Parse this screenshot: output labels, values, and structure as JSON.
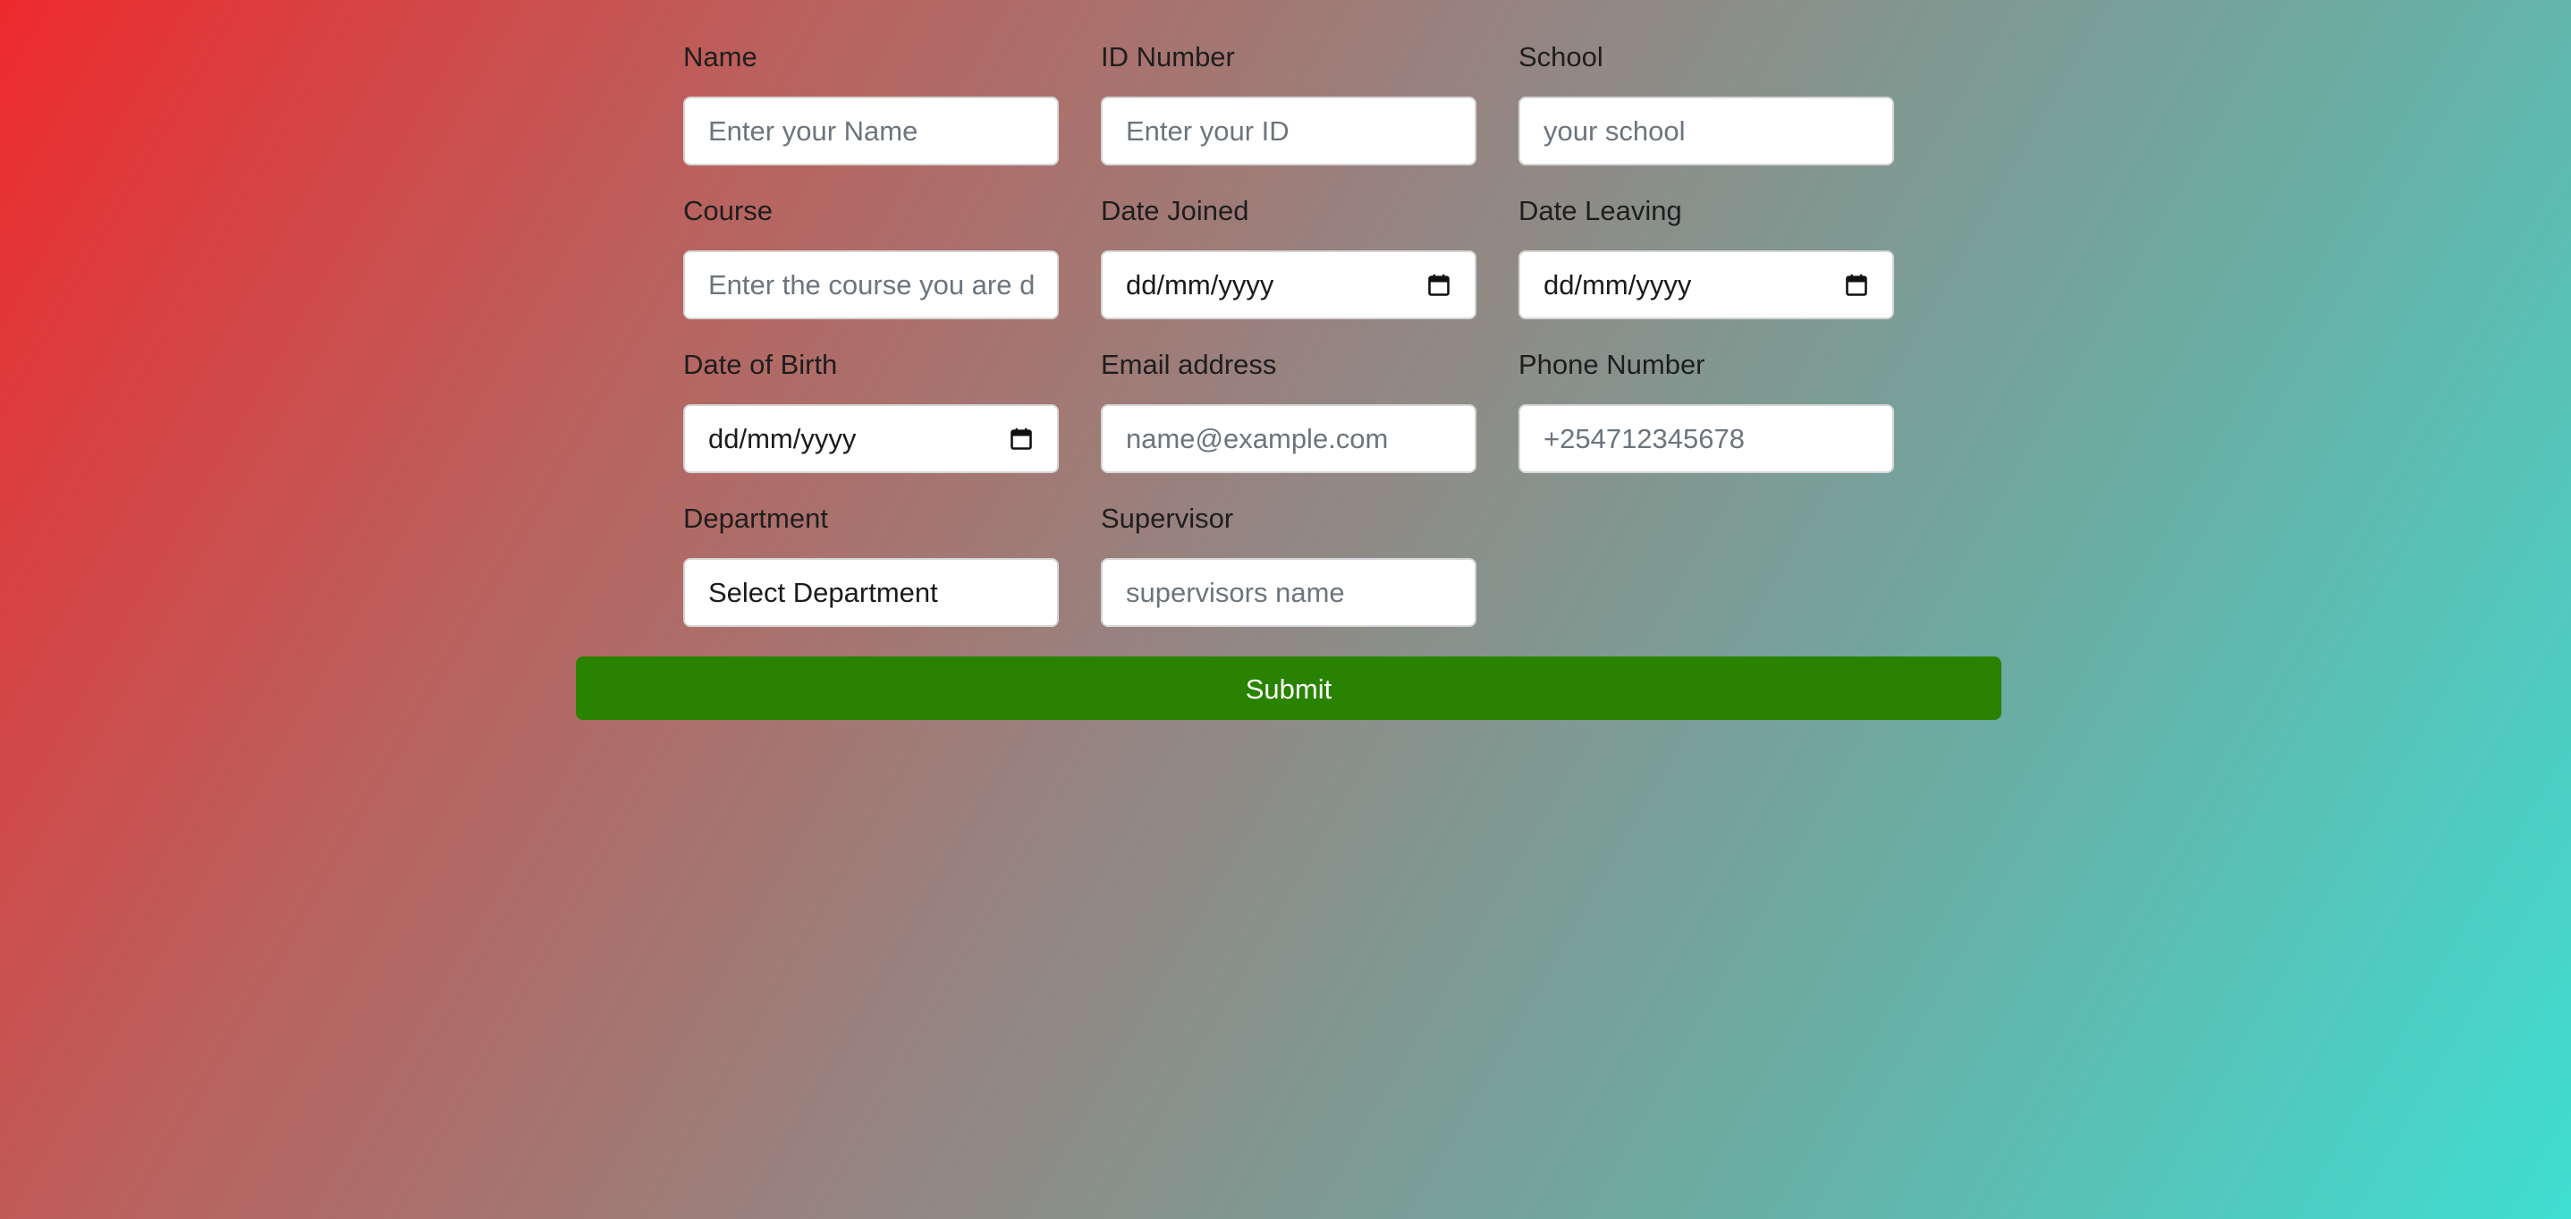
{
  "form": {
    "name": {
      "label": "Name",
      "placeholder": "Enter your Name"
    },
    "id_number": {
      "label": "ID Number",
      "placeholder": "Enter your ID"
    },
    "school": {
      "label": "School",
      "placeholder": "your school"
    },
    "course": {
      "label": "Course",
      "placeholder": "Enter the course you are d"
    },
    "date_joined": {
      "label": "Date Joined",
      "value": "dd/mm/yyyy",
      "icon": "calendar-icon"
    },
    "date_leaving": {
      "label": "Date Leaving",
      "value": "dd/mm/yyyy",
      "icon": "calendar-icon"
    },
    "date_of_birth": {
      "label": "Date of Birth",
      "value": "dd/mm/yyyy",
      "icon": "calendar-icon"
    },
    "email": {
      "label": "Email address",
      "placeholder": "name@example.com"
    },
    "phone": {
      "label": "Phone Number",
      "placeholder": "+254712345678"
    },
    "department": {
      "label": "Department",
      "selected": "Select Department"
    },
    "supervisor": {
      "label": "Supervisor",
      "placeholder": "supervisors name"
    },
    "submit_label": "Submit"
  },
  "colors": {
    "gradient_start": "#ee2a2e",
    "gradient_end": "#3fded2",
    "submit_bg": "#2a8300",
    "input_bg": "#ffffff"
  }
}
